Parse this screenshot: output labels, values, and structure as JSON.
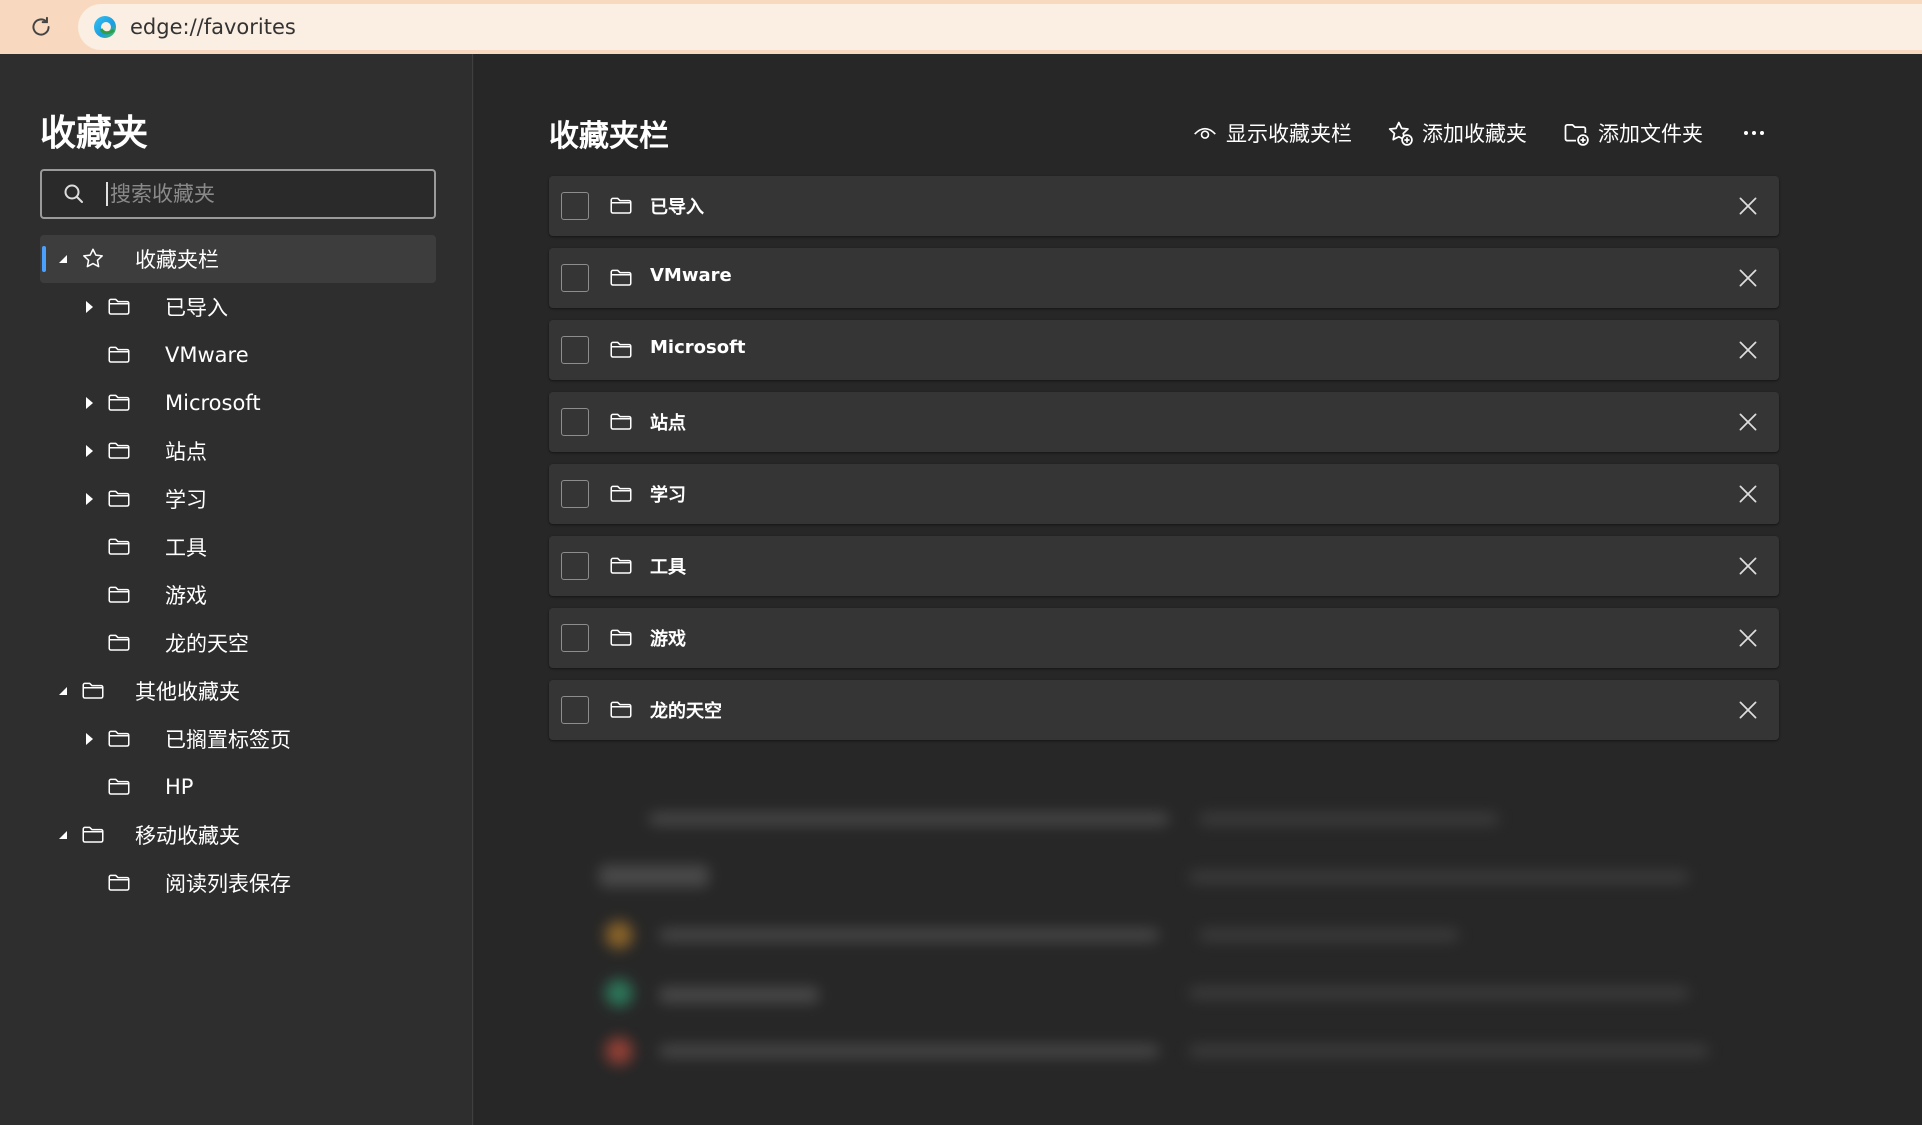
{
  "address_bar": {
    "url": "edge://favorites"
  },
  "sidebar": {
    "title": "收藏夹",
    "search_placeholder": "搜索收藏夹",
    "tree": [
      {
        "label": "收藏夹栏",
        "icon": "star-icon",
        "level": 0,
        "caret": "expanded",
        "selected": true
      },
      {
        "label": "已导入",
        "icon": "folder-icon",
        "level": 1,
        "caret": "collapsed"
      },
      {
        "label": "VMware",
        "icon": "folder-icon",
        "level": 1,
        "caret": "none"
      },
      {
        "label": "Microsoft",
        "icon": "folder-icon",
        "level": 1,
        "caret": "collapsed"
      },
      {
        "label": "站点",
        "icon": "folder-icon",
        "level": 1,
        "caret": "collapsed"
      },
      {
        "label": "学习",
        "icon": "folder-icon",
        "level": 1,
        "caret": "collapsed"
      },
      {
        "label": "工具",
        "icon": "folder-icon",
        "level": 1,
        "caret": "none"
      },
      {
        "label": "游戏",
        "icon": "folder-icon",
        "level": 1,
        "caret": "none"
      },
      {
        "label": "龙的天空",
        "icon": "folder-icon",
        "level": 1,
        "caret": "none"
      },
      {
        "label": "其他收藏夹",
        "icon": "folder-icon",
        "level": 0,
        "caret": "expanded"
      },
      {
        "label": "已搁置标签页",
        "icon": "folder-icon",
        "level": 1,
        "caret": "collapsed"
      },
      {
        "label": "HP",
        "icon": "folder-icon",
        "level": 1,
        "caret": "none"
      },
      {
        "label": "移动收藏夹",
        "icon": "folder-icon",
        "level": 0,
        "caret": "expanded"
      },
      {
        "label": "阅读列表保存",
        "icon": "folder-icon",
        "level": 1,
        "caret": "none"
      }
    ]
  },
  "main": {
    "title": "收藏夹栏",
    "actions": {
      "show_bar": "显示收藏夹栏",
      "add_favorite": "添加收藏夹",
      "add_folder": "添加文件夹",
      "more": "more-options-icon"
    },
    "rows": [
      "已导入",
      "VMware",
      "Microsoft",
      "站点",
      "学习",
      "工具",
      "游戏",
      "龙的天空"
    ]
  },
  "colors": {
    "address_bar_bg": "#f8d9bf",
    "accent": "#4aa0ff",
    "sidebar_bg": "#2e2e2e",
    "main_bg": "#272727",
    "row_bg": "#353535"
  }
}
